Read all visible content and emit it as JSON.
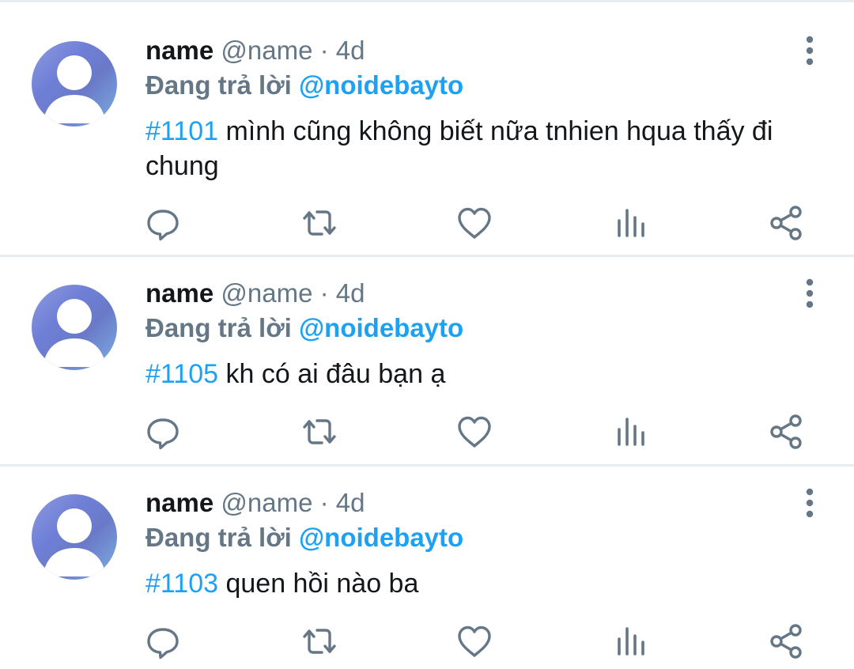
{
  "tweets": [
    {
      "display_name": "name",
      "handle": "@name",
      "separator": "·",
      "time": "4d",
      "reply_prefix": "Đang trả lời",
      "reply_to": "@noidebayto",
      "hashtag": "#1101",
      "text": " mình cũng không biết nữa tnhien hqua thấy đi chung"
    },
    {
      "display_name": "name",
      "handle": "@name",
      "separator": "·",
      "time": "4d",
      "reply_prefix": "Đang trả lời",
      "reply_to": "@noidebayto",
      "hashtag": "#1105",
      "text": " kh có ai đâu bạn ạ"
    },
    {
      "display_name": "name",
      "handle": "@name",
      "separator": "·",
      "time": "4d",
      "reply_prefix": "Đang trả lời",
      "reply_to": "@noidebayto",
      "hashtag": "#1103",
      "text": " quen hồi nào ba"
    }
  ],
  "icons": {
    "avatar": "default-user-avatar",
    "more": "more-vertical-icon",
    "reply": "reply-icon",
    "retweet": "retweet-icon",
    "like": "heart-icon",
    "views": "analytics-icon",
    "share": "share-icon"
  },
  "colors": {
    "text": "#14171a",
    "secondary": "#657786",
    "accent": "#1da1f2",
    "divider": "#e6ecf0"
  }
}
